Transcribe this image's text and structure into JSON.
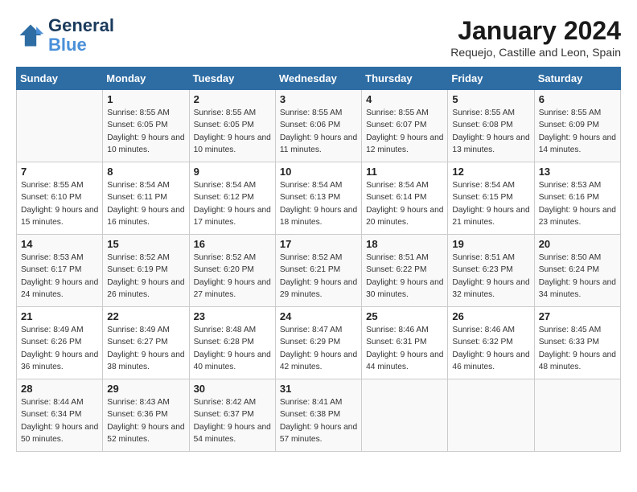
{
  "header": {
    "logo_line1": "General",
    "logo_line2": "Blue",
    "month_year": "January 2024",
    "location": "Requejo, Castille and Leon, Spain"
  },
  "weekdays": [
    "Sunday",
    "Monday",
    "Tuesday",
    "Wednesday",
    "Thursday",
    "Friday",
    "Saturday"
  ],
  "weeks": [
    [
      {
        "day": "",
        "sunrise": "",
        "sunset": "",
        "daylight": ""
      },
      {
        "day": "1",
        "sunrise": "Sunrise: 8:55 AM",
        "sunset": "Sunset: 6:05 PM",
        "daylight": "Daylight: 9 hours and 10 minutes."
      },
      {
        "day": "2",
        "sunrise": "Sunrise: 8:55 AM",
        "sunset": "Sunset: 6:05 PM",
        "daylight": "Daylight: 9 hours and 10 minutes."
      },
      {
        "day": "3",
        "sunrise": "Sunrise: 8:55 AM",
        "sunset": "Sunset: 6:06 PM",
        "daylight": "Daylight: 9 hours and 11 minutes."
      },
      {
        "day": "4",
        "sunrise": "Sunrise: 8:55 AM",
        "sunset": "Sunset: 6:07 PM",
        "daylight": "Daylight: 9 hours and 12 minutes."
      },
      {
        "day": "5",
        "sunrise": "Sunrise: 8:55 AM",
        "sunset": "Sunset: 6:08 PM",
        "daylight": "Daylight: 9 hours and 13 minutes."
      },
      {
        "day": "6",
        "sunrise": "Sunrise: 8:55 AM",
        "sunset": "Sunset: 6:09 PM",
        "daylight": "Daylight: 9 hours and 14 minutes."
      }
    ],
    [
      {
        "day": "7",
        "sunrise": "Sunrise: 8:55 AM",
        "sunset": "Sunset: 6:10 PM",
        "daylight": "Daylight: 9 hours and 15 minutes."
      },
      {
        "day": "8",
        "sunrise": "Sunrise: 8:54 AM",
        "sunset": "Sunset: 6:11 PM",
        "daylight": "Daylight: 9 hours and 16 minutes."
      },
      {
        "day": "9",
        "sunrise": "Sunrise: 8:54 AM",
        "sunset": "Sunset: 6:12 PM",
        "daylight": "Daylight: 9 hours and 17 minutes."
      },
      {
        "day": "10",
        "sunrise": "Sunrise: 8:54 AM",
        "sunset": "Sunset: 6:13 PM",
        "daylight": "Daylight: 9 hours and 18 minutes."
      },
      {
        "day": "11",
        "sunrise": "Sunrise: 8:54 AM",
        "sunset": "Sunset: 6:14 PM",
        "daylight": "Daylight: 9 hours and 20 minutes."
      },
      {
        "day": "12",
        "sunrise": "Sunrise: 8:54 AM",
        "sunset": "Sunset: 6:15 PM",
        "daylight": "Daylight: 9 hours and 21 minutes."
      },
      {
        "day": "13",
        "sunrise": "Sunrise: 8:53 AM",
        "sunset": "Sunset: 6:16 PM",
        "daylight": "Daylight: 9 hours and 23 minutes."
      }
    ],
    [
      {
        "day": "14",
        "sunrise": "Sunrise: 8:53 AM",
        "sunset": "Sunset: 6:17 PM",
        "daylight": "Daylight: 9 hours and 24 minutes."
      },
      {
        "day": "15",
        "sunrise": "Sunrise: 8:52 AM",
        "sunset": "Sunset: 6:19 PM",
        "daylight": "Daylight: 9 hours and 26 minutes."
      },
      {
        "day": "16",
        "sunrise": "Sunrise: 8:52 AM",
        "sunset": "Sunset: 6:20 PM",
        "daylight": "Daylight: 9 hours and 27 minutes."
      },
      {
        "day": "17",
        "sunrise": "Sunrise: 8:52 AM",
        "sunset": "Sunset: 6:21 PM",
        "daylight": "Daylight: 9 hours and 29 minutes."
      },
      {
        "day": "18",
        "sunrise": "Sunrise: 8:51 AM",
        "sunset": "Sunset: 6:22 PM",
        "daylight": "Daylight: 9 hours and 30 minutes."
      },
      {
        "day": "19",
        "sunrise": "Sunrise: 8:51 AM",
        "sunset": "Sunset: 6:23 PM",
        "daylight": "Daylight: 9 hours and 32 minutes."
      },
      {
        "day": "20",
        "sunrise": "Sunrise: 8:50 AM",
        "sunset": "Sunset: 6:24 PM",
        "daylight": "Daylight: 9 hours and 34 minutes."
      }
    ],
    [
      {
        "day": "21",
        "sunrise": "Sunrise: 8:49 AM",
        "sunset": "Sunset: 6:26 PM",
        "daylight": "Daylight: 9 hours and 36 minutes."
      },
      {
        "day": "22",
        "sunrise": "Sunrise: 8:49 AM",
        "sunset": "Sunset: 6:27 PM",
        "daylight": "Daylight: 9 hours and 38 minutes."
      },
      {
        "day": "23",
        "sunrise": "Sunrise: 8:48 AM",
        "sunset": "Sunset: 6:28 PM",
        "daylight": "Daylight: 9 hours and 40 minutes."
      },
      {
        "day": "24",
        "sunrise": "Sunrise: 8:47 AM",
        "sunset": "Sunset: 6:29 PM",
        "daylight": "Daylight: 9 hours and 42 minutes."
      },
      {
        "day": "25",
        "sunrise": "Sunrise: 8:46 AM",
        "sunset": "Sunset: 6:31 PM",
        "daylight": "Daylight: 9 hours and 44 minutes."
      },
      {
        "day": "26",
        "sunrise": "Sunrise: 8:46 AM",
        "sunset": "Sunset: 6:32 PM",
        "daylight": "Daylight: 9 hours and 46 minutes."
      },
      {
        "day": "27",
        "sunrise": "Sunrise: 8:45 AM",
        "sunset": "Sunset: 6:33 PM",
        "daylight": "Daylight: 9 hours and 48 minutes."
      }
    ],
    [
      {
        "day": "28",
        "sunrise": "Sunrise: 8:44 AM",
        "sunset": "Sunset: 6:34 PM",
        "daylight": "Daylight: 9 hours and 50 minutes."
      },
      {
        "day": "29",
        "sunrise": "Sunrise: 8:43 AM",
        "sunset": "Sunset: 6:36 PM",
        "daylight": "Daylight: 9 hours and 52 minutes."
      },
      {
        "day": "30",
        "sunrise": "Sunrise: 8:42 AM",
        "sunset": "Sunset: 6:37 PM",
        "daylight": "Daylight: 9 hours and 54 minutes."
      },
      {
        "day": "31",
        "sunrise": "Sunrise: 8:41 AM",
        "sunset": "Sunset: 6:38 PM",
        "daylight": "Daylight: 9 hours and 57 minutes."
      },
      {
        "day": "",
        "sunrise": "",
        "sunset": "",
        "daylight": ""
      },
      {
        "day": "",
        "sunrise": "",
        "sunset": "",
        "daylight": ""
      },
      {
        "day": "",
        "sunrise": "",
        "sunset": "",
        "daylight": ""
      }
    ]
  ]
}
